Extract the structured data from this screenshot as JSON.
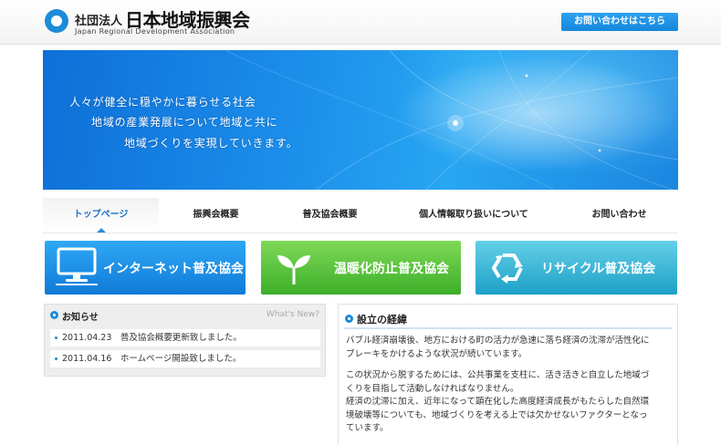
{
  "header": {
    "org_type": "社団法人",
    "org_name": "日本地域振興会",
    "org_name_en": "Japan Regional Development Association",
    "contact_button": "お問い合わせはこちら"
  },
  "hero": {
    "lines": [
      "人々が健全に穏やかに暮らせる社会",
      "地域の産業発展について地域と共に",
      "地域づくりを実現していきます。"
    ]
  },
  "nav": {
    "items": [
      {
        "label": "トップページ",
        "active": true
      },
      {
        "label": "振興会概要"
      },
      {
        "label": "普及協会概要"
      },
      {
        "label": "個人情報取り扱いについて"
      },
      {
        "label": "お問い合わせ"
      }
    ]
  },
  "banners": [
    {
      "label": "インターネット普及協会",
      "icon": "monitor-icon"
    },
    {
      "label": "温暖化防止普及協会",
      "icon": "sprout-icon"
    },
    {
      "label": "リサイクル普及協会",
      "icon": "recycle-icon"
    }
  ],
  "news": {
    "title": "お知らせ",
    "whats_new": "What's New?",
    "items": [
      {
        "text": "2011.04.23　普及協会概要更新致しました。"
      },
      {
        "text": "2011.04.16　ホームページ開設致しました。"
      }
    ]
  },
  "about": {
    "title": "設立の経緯",
    "paragraphs": [
      [
        "バブル経済崩壊後、地方における町の活力が急速に落ち経済の沈滞が活性化に",
        "ブレーキをかけるような状況が続いています。"
      ],
      [
        "この状況から脱するためには、公共事業を支柱に、活き活きと自立した地域づ",
        "くりを目指して活動しなければなりません。",
        "経済の沈滞に加え、近年になって顕在化した高度経済成長がもたらした自然環",
        "境破壊等についても、地域づくりを考える上では欠かせないファクターとなっ",
        "ています。"
      ]
    ]
  },
  "colors": {
    "accent": "#1e8bd8",
    "banner_blue": "#1a8ae6",
    "banner_green": "#52c03a",
    "banner_teal": "#3bbcd8"
  }
}
